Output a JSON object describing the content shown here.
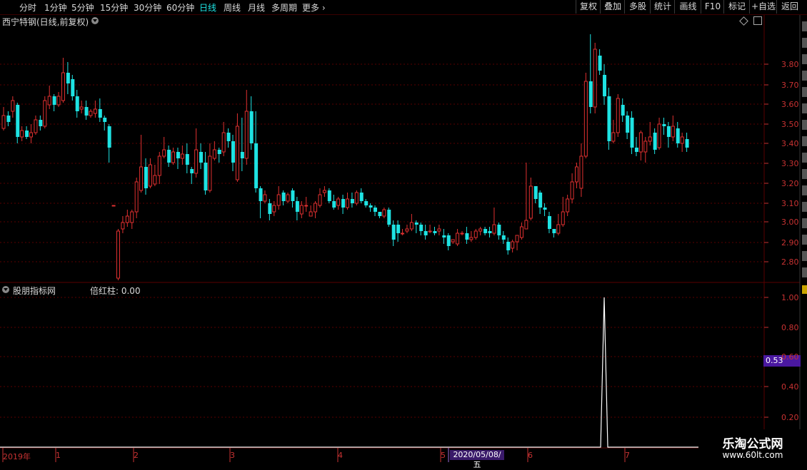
{
  "toolbar": {
    "periods": [
      {
        "label": "分时",
        "active": false
      },
      {
        "label": "1分钟",
        "active": false
      },
      {
        "label": "5分钟",
        "active": false
      },
      {
        "label": "15分钟",
        "active": false
      },
      {
        "label": "30分钟",
        "active": false
      },
      {
        "label": "60分钟",
        "active": false
      },
      {
        "label": "日线",
        "active": true
      },
      {
        "label": "周线",
        "active": false
      },
      {
        "label": "月线",
        "active": false
      },
      {
        "label": "多周期",
        "active": false
      },
      {
        "label": "更多",
        "active": false
      }
    ],
    "right_buttons": [
      "复权",
      "叠加",
      "多股",
      "统计",
      "画线",
      "F10",
      "标记",
      "+自选",
      "返回"
    ]
  },
  "price_panel": {
    "title": "西宁特钢(日线,前复权)",
    "axis_labels": [
      "3.80",
      "3.70",
      "3.60",
      "3.50",
      "3.40",
      "3.30",
      "3.20",
      "3.10",
      "3.00",
      "2.90",
      "2.80"
    ]
  },
  "indicator_panel": {
    "title": "股朋指标网",
    "value_label": "倍红柱: 0.00",
    "axis_labels": [
      "1.00",
      "0.80",
      "0.60",
      "0.40",
      "0.20"
    ],
    "highlight_value": "0.53"
  },
  "time_axis": {
    "labels": [
      "2019年",
      "1",
      "2",
      "3",
      "4",
      "5",
      "6",
      "7"
    ],
    "cursor_date": "2020/05/08/五"
  },
  "watermark": {
    "title": "乐淘公式网",
    "url": "www.60lt.com"
  },
  "colors": {
    "up": "#e03030",
    "down": "#1ee3e3",
    "axis": "#c83232",
    "grid": "#5a0000",
    "highlight": "#4a18a0"
  },
  "chart_data": [
    {
      "type": "candlestick",
      "title": "西宁特钢(日线,前复权)",
      "ylim": [
        2.74,
        3.95
      ],
      "candles": [
        [
          3.47,
          3.53,
          3.46,
          3.57
        ],
        [
          3.53,
          3.5,
          3.48,
          3.55
        ],
        [
          3.55,
          3.6,
          3.52,
          3.62
        ],
        [
          3.58,
          3.43,
          3.4,
          3.59
        ],
        [
          3.43,
          3.46,
          3.41,
          3.48
        ],
        [
          3.46,
          3.43,
          3.42,
          3.48
        ],
        [
          3.43,
          3.45,
          3.4,
          3.49
        ],
        [
          3.45,
          3.51,
          3.44,
          3.53
        ],
        [
          3.51,
          3.48,
          3.46,
          3.53
        ],
        [
          3.48,
          3.6,
          3.47,
          3.62
        ],
        [
          3.58,
          3.62,
          3.56,
          3.67
        ],
        [
          3.62,
          3.58,
          3.55,
          3.63
        ],
        [
          3.58,
          3.62,
          3.57,
          3.64
        ],
        [
          3.6,
          3.73,
          3.59,
          3.8
        ],
        [
          3.73,
          3.68,
          3.63,
          3.78
        ],
        [
          3.7,
          3.62,
          3.6,
          3.72
        ],
        [
          3.62,
          3.55,
          3.52,
          3.65
        ],
        [
          3.56,
          3.57,
          3.54,
          3.6
        ],
        [
          3.57,
          3.53,
          3.51,
          3.6
        ],
        [
          3.53,
          3.55,
          3.52,
          3.56
        ],
        [
          3.54,
          3.56,
          3.52,
          3.6
        ],
        [
          3.56,
          3.52,
          3.5,
          3.61
        ],
        [
          3.52,
          3.5,
          3.46,
          3.53
        ],
        [
          3.48,
          3.38,
          3.31,
          3.49
        ],
        [
          3.11,
          3.11,
          3.11,
          3.11
        ],
        [
          2.77,
          2.99,
          2.76,
          3.0
        ],
        [
          3.0,
          3.03,
          2.98,
          3.06
        ],
        [
          3.03,
          3.06,
          3.01,
          3.09
        ],
        [
          3.03,
          3.08,
          3.0,
          3.09
        ],
        [
          3.08,
          3.22,
          3.05,
          3.24
        ],
        [
          3.18,
          3.29,
          3.17,
          3.44
        ],
        [
          3.29,
          3.19,
          3.16,
          3.33
        ],
        [
          3.2,
          3.3,
          3.19,
          3.33
        ],
        [
          3.21,
          3.25,
          3.2,
          3.3
        ],
        [
          3.25,
          3.34,
          3.21,
          3.36
        ],
        [
          3.34,
          3.37,
          3.33,
          3.43
        ],
        [
          3.37,
          3.31,
          3.29,
          3.39
        ],
        [
          3.31,
          3.36,
          3.3,
          3.38
        ],
        [
          3.36,
          3.33,
          3.28,
          3.38
        ],
        [
          3.33,
          3.35,
          3.3,
          3.39
        ],
        [
          3.35,
          3.3,
          3.26,
          3.4
        ],
        [
          3.28,
          3.26,
          3.21,
          3.29
        ],
        [
          3.26,
          3.37,
          3.24,
          3.47
        ],
        [
          3.36,
          3.31,
          3.28,
          3.4
        ],
        [
          3.31,
          3.18,
          3.16,
          3.36
        ],
        [
          3.18,
          3.34,
          3.17,
          3.4
        ],
        [
          3.33,
          3.37,
          3.32,
          3.41
        ],
        [
          3.37,
          3.35,
          3.31,
          3.38
        ],
        [
          3.36,
          3.45,
          3.34,
          3.5
        ],
        [
          3.45,
          3.41,
          3.38,
          3.47
        ],
        [
          3.41,
          3.31,
          3.27,
          3.44
        ],
        [
          3.23,
          3.48,
          3.22,
          3.54
        ],
        [
          3.36,
          3.33,
          3.27,
          3.52
        ],
        [
          3.33,
          3.55,
          3.3,
          3.65
        ],
        [
          3.55,
          3.4,
          3.37,
          3.62
        ],
        [
          3.4,
          3.19,
          3.17,
          3.55
        ],
        [
          3.19,
          3.13,
          3.05,
          3.2
        ],
        [
          3.13,
          3.16,
          3.12,
          3.18
        ],
        [
          3.12,
          3.07,
          3.04,
          3.14
        ],
        [
          3.08,
          3.11,
          3.06,
          3.13
        ],
        [
          3.11,
          3.16,
          3.09,
          3.2
        ],
        [
          3.17,
          3.13,
          3.11,
          3.18
        ],
        [
          3.13,
          3.16,
          3.12,
          3.17
        ],
        [
          3.18,
          3.13,
          3.1,
          3.19
        ],
        [
          3.13,
          3.08,
          3.04,
          3.15
        ],
        [
          3.07,
          3.11,
          3.05,
          3.13
        ],
        [
          3.11,
          3.11,
          3.08,
          3.15
        ],
        [
          3.06,
          3.08,
          3.06,
          3.11
        ],
        [
          3.08,
          3.12,
          3.05,
          3.13
        ],
        [
          3.11,
          3.16,
          3.1,
          3.19
        ],
        [
          3.17,
          3.18,
          3.15,
          3.2
        ],
        [
          3.18,
          3.13,
          3.12,
          3.19
        ],
        [
          3.13,
          3.1,
          3.09,
          3.16
        ],
        [
          3.11,
          3.14,
          3.09,
          3.15
        ],
        [
          3.14,
          3.1,
          3.07,
          3.16
        ],
        [
          3.1,
          3.14,
          3.09,
          3.17
        ],
        [
          3.14,
          3.12,
          3.1,
          3.17
        ],
        [
          3.12,
          3.17,
          3.11,
          3.18
        ],
        [
          3.17,
          3.13,
          3.12,
          3.19
        ],
        [
          3.13,
          3.11,
          3.1,
          3.14
        ],
        [
          3.11,
          3.1,
          3.08,
          3.12
        ],
        [
          3.1,
          3.08,
          3.06,
          3.11
        ],
        [
          3.08,
          3.06,
          3.05,
          3.08
        ],
        [
          3.06,
          3.09,
          3.05,
          3.1
        ],
        [
          3.09,
          3.02,
          3.01,
          3.1
        ],
        [
          3.02,
          2.95,
          2.92,
          3.04
        ],
        [
          3.02,
          2.98,
          2.94,
          3.04
        ],
        [
          2.98,
          2.98,
          2.97,
          3.0
        ],
        [
          2.99,
          3.0,
          2.98,
          3.02
        ],
        [
          3.0,
          3.03,
          2.99,
          3.07
        ],
        [
          3.03,
          3.02,
          2.98,
          3.04
        ],
        [
          3.02,
          2.99,
          2.97,
          3.03
        ],
        [
          2.99,
          2.97,
          2.95,
          3.02
        ],
        [
          2.99,
          2.99,
          2.98,
          3.02
        ],
        [
          2.99,
          2.98,
          2.97,
          3.01
        ],
        [
          2.99,
          3.0,
          2.97,
          3.02
        ],
        [
          2.97,
          2.96,
          2.93,
          3.0
        ],
        [
          2.97,
          2.92,
          2.9,
          2.98
        ],
        [
          2.94,
          2.95,
          2.93,
          2.95
        ],
        [
          2.93,
          2.98,
          2.92,
          3.0
        ],
        [
          2.98,
          2.98,
          2.97,
          2.99
        ],
        [
          2.98,
          2.95,
          2.93,
          3.01
        ],
        [
          2.95,
          2.96,
          2.94,
          2.99
        ],
        [
          2.96,
          2.99,
          2.95,
          3.0
        ],
        [
          2.99,
          3.0,
          2.97,
          3.01
        ],
        [
          3.0,
          2.98,
          2.97,
          3.01
        ],
        [
          2.99,
          2.98,
          2.96,
          3.01
        ],
        [
          2.98,
          3.02,
          2.97,
          3.1
        ],
        [
          3.02,
          2.97,
          2.95,
          3.03
        ],
        [
          2.97,
          2.95,
          2.93,
          2.99
        ],
        [
          2.94,
          2.9,
          2.88,
          2.96
        ],
        [
          2.91,
          2.94,
          2.89,
          2.95
        ],
        [
          2.94,
          2.97,
          2.9,
          2.97
        ],
        [
          2.96,
          3.01,
          2.95,
          3.03
        ],
        [
          3.0,
          3.04,
          3.0,
          3.31
        ],
        [
          3.05,
          3.2,
          3.04,
          3.24
        ],
        [
          3.2,
          3.14,
          3.12,
          3.18
        ],
        [
          3.17,
          3.1,
          3.07,
          3.18
        ],
        [
          3.1,
          3.09,
          3.06,
          3.12
        ],
        [
          3.06,
          3.0,
          2.98,
          3.08
        ],
        [
          3.0,
          2.98,
          2.96,
          3.0
        ],
        [
          2.98,
          3.02,
          2.97,
          3.07
        ],
        [
          3.02,
          3.08,
          3.01,
          3.15
        ],
        [
          3.08,
          3.14,
          3.06,
          3.16
        ],
        [
          3.14,
          3.22,
          3.12,
          3.26
        ],
        [
          3.22,
          3.29,
          3.19,
          3.31
        ],
        [
          3.19,
          3.34,
          3.15,
          3.4
        ],
        [
          3.34,
          3.69,
          3.33,
          3.73
        ],
        [
          3.69,
          3.57,
          3.54,
          3.91
        ],
        [
          3.57,
          3.84,
          3.54,
          3.87
        ],
        [
          3.81,
          3.74,
          3.72,
          3.84
        ],
        [
          3.72,
          3.62,
          3.58,
          3.77
        ],
        [
          3.62,
          3.41,
          3.37,
          3.66
        ],
        [
          3.41,
          3.45,
          3.4,
          3.51
        ],
        [
          3.45,
          3.61,
          3.43,
          3.63
        ],
        [
          3.58,
          3.53,
          3.5,
          3.61
        ],
        [
          3.53,
          3.45,
          3.42,
          3.55
        ],
        [
          3.52,
          3.38,
          3.35,
          3.55
        ],
        [
          3.38,
          3.36,
          3.34,
          3.43
        ],
        [
          3.36,
          3.45,
          3.32,
          3.46
        ],
        [
          3.36,
          3.41,
          3.31,
          3.43
        ],
        [
          3.41,
          3.43,
          3.39,
          3.5
        ],
        [
          3.45,
          3.37,
          3.35,
          3.47
        ],
        [
          3.38,
          3.49,
          3.37,
          3.52
        ],
        [
          3.49,
          3.48,
          3.44,
          3.52
        ],
        [
          3.48,
          3.43,
          3.38,
          3.5
        ],
        [
          3.43,
          3.48,
          3.41,
          3.53
        ],
        [
          3.47,
          3.4,
          3.38,
          3.5
        ],
        [
          3.4,
          3.43,
          3.36,
          3.45
        ],
        [
          3.42,
          3.38,
          3.36,
          3.45
        ]
      ]
    },
    {
      "type": "line",
      "title": "股朋指标网",
      "ylim": [
        0,
        1.08
      ],
      "spike": {
        "index": 131,
        "value": 1.0
      }
    }
  ]
}
